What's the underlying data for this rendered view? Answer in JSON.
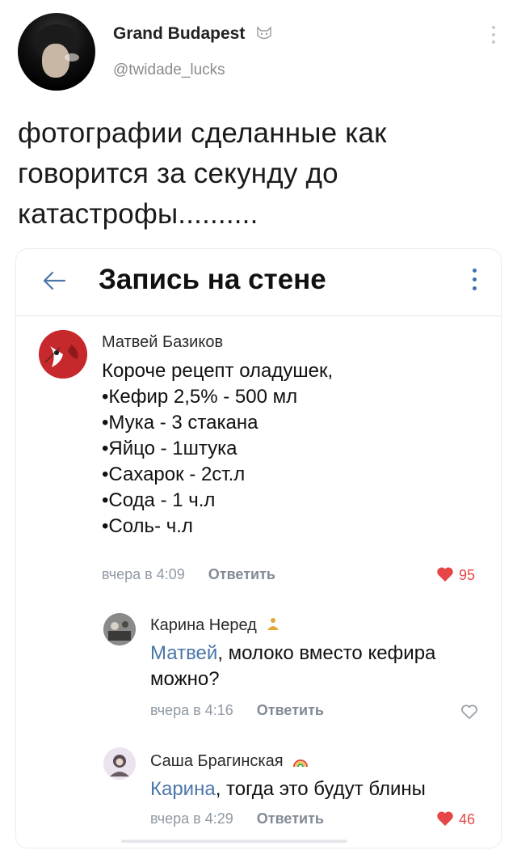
{
  "tweet": {
    "display_name": "Grand Budapest",
    "handle": "@twidade_lucks",
    "text_lines": [
      "фотографии сделанные как",
      "говорится за секунду до",
      "катастрофы.........."
    ]
  },
  "vk": {
    "title": "Запись на стене",
    "accent_color": "#4a76a8",
    "like_color": "#e64646",
    "post": {
      "author": "Матвей Базиков",
      "lines": [
        "Короче рецепт оладушек,",
        "•Кефир 2,5% - 500 мл",
        "•Мука - 3 стакана",
        "•Яйцо - 1штука",
        "•Сахарок - 2ст.л",
        "•Сода - 1 ч.л",
        "•Соль- ч.л"
      ],
      "time": "вчера в 4:09",
      "reply_label": "Ответить",
      "likes": "95"
    },
    "comments": [
      {
        "author": "Карина Неред",
        "mention": "Матвей",
        "text_after_mention": ", молоко вместо кефира",
        "text_line2": "можно?",
        "time": "вчера в 4:16",
        "reply_label": "Ответить",
        "like_icon": "heart-outline-icon"
      },
      {
        "author": "Саша Брагинская",
        "mention": "Карина",
        "text_after_mention": ", тогда это будут блины",
        "time": "вчера в 4:29",
        "reply_label": "Ответить",
        "likes": "46"
      }
    ]
  }
}
